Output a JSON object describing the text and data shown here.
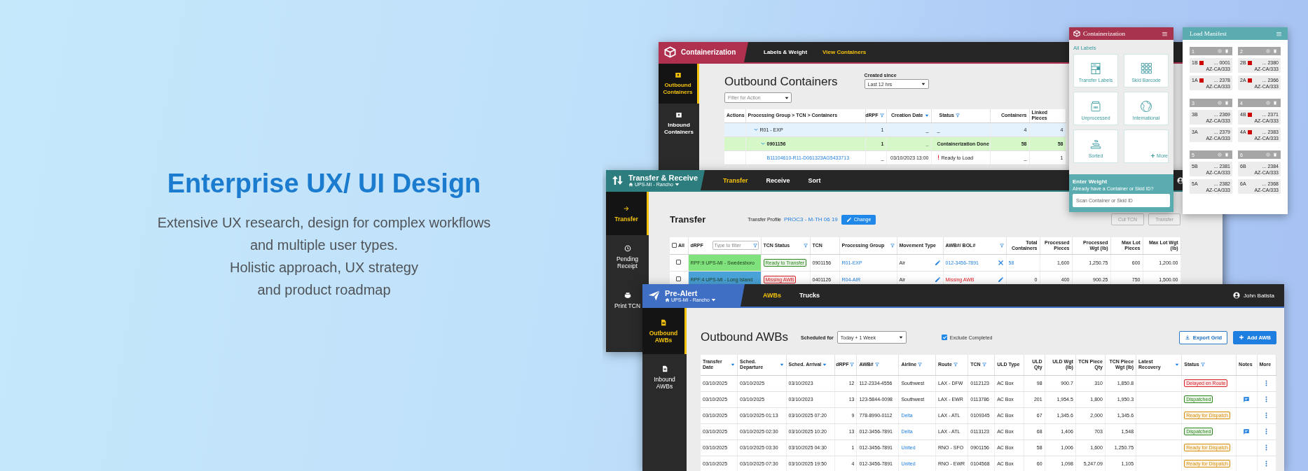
{
  "hero": {
    "title": "Enterprise UX/ UI Design",
    "lines": [
      "Extensive UX research, design for complex workflows",
      "and multiple user types.",
      "Holistic approach, UX strategy",
      "and product roadmap"
    ]
  },
  "containerization_window": {
    "app_title": "Containerization",
    "nav_tabs": [
      {
        "label": "Labels & Weight",
        "selected": false
      },
      {
        "label": "View Containers",
        "selected": true
      }
    ],
    "sidebar": [
      {
        "label": "Outbound Containers",
        "selected": true
      },
      {
        "label": "Inbound Containers",
        "selected": false
      }
    ],
    "page_title": "Outbound Containers",
    "created_since": {
      "label": "Created since",
      "value": "Last 12 hrs"
    },
    "action_filter": {
      "placeholder": "Filter for Action"
    },
    "table": {
      "columns": [
        {
          "label": "Actions"
        },
        {
          "label": "Processing Group > TCN > Containers"
        },
        {
          "label": "dRPF",
          "kind": "filter"
        },
        {
          "label": "Creation Date",
          "kind": "sort"
        },
        {
          "label": "Status",
          "kind": "filter"
        },
        {
          "label": "Containers"
        },
        {
          "label": "Linked Pieces"
        }
      ],
      "rows": [
        {
          "kind": "group",
          "expanded": true,
          "cells": [
            "",
            "R01 - EXP",
            "1",
            "_",
            "_",
            "4",
            "4"
          ]
        },
        {
          "kind": "tcn",
          "expanded": true,
          "cells": [
            "",
            "0901156",
            "1",
            "_",
            "Containerization Done",
            "58",
            "58"
          ]
        },
        {
          "kind": "container",
          "cells": [
            "",
            {
              "text": "B11104610-R11-D061323AG5433713",
              "kind": "link"
            },
            "_",
            "03/10/2023 13:00",
            {
              "text": "Ready to Load",
              "kind": "alert"
            },
            "_",
            "1"
          ]
        }
      ]
    }
  },
  "transfer_window": {
    "app_title": "Transfer & Receive",
    "location": "UPS-MI - Rancho",
    "nav_tabs": [
      {
        "label": "Transfer",
        "selected": true
      },
      {
        "label": "Receive",
        "selected": false
      },
      {
        "label": "Sort",
        "selected": false
      }
    ],
    "sidebar": [
      {
        "label": "Transfer",
        "selected": true
      },
      {
        "label": "Pending Receipt",
        "selected": false
      },
      {
        "label": "Print TCN",
        "selected": false
      }
    ],
    "page_title": "Transfer",
    "profile": {
      "label": "Transfer Profile",
      "value": "PROC3 - M-TH 06 19",
      "button": "Change"
    },
    "actions": [
      {
        "label": "Cut TCN",
        "disabled": true
      },
      {
        "label": "Transfer",
        "disabled": true
      }
    ],
    "table": {
      "columns": [
        {
          "label": "All",
          "kind": "select-all",
          "checked": false
        },
        {
          "label": "dRPF",
          "kind": "filter-field",
          "placeholder": "Type to filter"
        },
        {
          "label": "TCN Status",
          "kind": "filter"
        },
        {
          "label": "TCN"
        },
        {
          "label": "Processing Group",
          "kind": "filter"
        },
        {
          "label": "Movement Type"
        },
        {
          "label": "AWB#/ BOL#",
          "kind": "filter"
        },
        {
          "label": "Total Containers"
        },
        {
          "label": "Processed Pieces"
        },
        {
          "label": "Processed Wgt (lb)"
        },
        {
          "label": "Max Lot Pieces"
        },
        {
          "label": "Max Lot Wgt (lb)"
        }
      ],
      "rows": [
        {
          "cells": [
            {
              "kind": "checkbox",
              "checked": false
            },
            {
              "text": "RPF:9 UPS-MI - Swedesboro",
              "kind": "rpf",
              "color": "#7fe27c"
            },
            {
              "text": "Ready to Transfer",
              "kind": "badge",
              "color": "#2f8a1f"
            },
            "0901156",
            {
              "text": "R01-EXP",
              "kind": "link"
            },
            {
              "text": "Air",
              "kind": "editable"
            },
            {
              "text": "012-3456-7891",
              "kind": "clearable"
            },
            {
              "text": "58",
              "kind": "link"
            },
            "1,600",
            "1,250.75",
            "600",
            "1,200.00"
          ]
        },
        {
          "cells": [
            {
              "kind": "checkbox",
              "checked": false
            },
            {
              "text": "RPF:4 UPS-MI - Long Island",
              "kind": "rpf",
              "color": "#4aa3d8"
            },
            {
              "text": "Missing AWB",
              "kind": "badge",
              "color": "#d8232a"
            },
            "0401126",
            {
              "text": "R04-AIR",
              "kind": "link"
            },
            {
              "text": "Air",
              "kind": "editable"
            },
            {
              "text": "Missing AWB",
              "kind": "missing"
            },
            "0",
            "400",
            "900.25",
            "750",
            "1,500.00"
          ]
        }
      ]
    }
  },
  "prealert_window": {
    "app_title": "Pre-Alert",
    "location": "UPS-MI - Rancho",
    "nav_tabs": [
      {
        "label": "AWBs",
        "selected": true
      },
      {
        "label": "Trucks",
        "selected": false
      }
    ],
    "user": "John Batista",
    "sidebar": [
      {
        "label": "Outbound AWBs",
        "selected": true
      },
      {
        "label": "Inbound AWBs",
        "selected": false
      }
    ],
    "page_title": "Outbound AWBs",
    "schedule": {
      "label": "Scheduled for",
      "value": "Today + 1 Week"
    },
    "exclude_completed": {
      "label": "Exclude Completed",
      "checked": true
    },
    "buttons": [
      {
        "label": "Export Grid",
        "kind": "export"
      },
      {
        "label": "Add AWB",
        "kind": "add"
      }
    ],
    "table": {
      "columns": [
        {
          "label": "Transfer Date",
          "kind": "sort"
        },
        {
          "label": "Sched. Departure",
          "kind": "sort"
        },
        {
          "label": "Sched. Arrival",
          "kind": "sort"
        },
        {
          "label": "dRPF",
          "kind": "filter"
        },
        {
          "label": "AWB#",
          "kind": "filter"
        },
        {
          "label": "Airline",
          "kind": "filter"
        },
        {
          "label": "Route",
          "kind": "filter"
        },
        {
          "label": "TCN",
          "kind": "filter"
        },
        {
          "label": "ULD Type"
        },
        {
          "label": "ULD Qty"
        },
        {
          "label": "ULD Wgt (lb)"
        },
        {
          "label": "TCN Piece Qty"
        },
        {
          "label": "TCN Piece Wgt (lb)"
        },
        {
          "label": "Latest Recovery",
          "kind": "sort"
        },
        {
          "label": "Status",
          "kind": "filter"
        },
        {
          "label": "Notes"
        },
        {
          "label": "More"
        }
      ],
      "rows": [
        {
          "has_note": false,
          "cells": [
            "03/10/2025",
            "03/10/2025",
            "03/10/2023",
            "12",
            "112-2334-4556",
            "Southwest",
            "LAX - DFW",
            "0112123",
            "AC Box",
            "98",
            "900.7",
            "310",
            "1,850.8",
            null,
            {
              "text": "Delayed en Route",
              "kind": "badge",
              "color": "#d8232a"
            }
          ]
        },
        {
          "has_note": true,
          "cells": [
            "03/10/2025",
            "03/10/2025",
            "03/10/2023",
            "13",
            "123-5844-0098",
            "Southwest",
            "LAX - EWR",
            "0113786",
            "AC Box",
            "201",
            "1,954.5",
            "1,800",
            "1,950.3",
            null,
            {
              "text": "Dispatched",
              "kind": "badge",
              "color": "#2f8a1f"
            }
          ]
        },
        {
          "has_note": false,
          "cells": [
            "03/10/2025",
            "03/10/2025 01:13",
            "03/10/2025 07:20",
            "9",
            "778-8990-0112",
            {
              "text": "Delta",
              "kind": "link"
            },
            "LAX - ATL",
            "0109345",
            "AC Box",
            "67",
            "1,345.6",
            "2,000",
            "1,345.6",
            null,
            {
              "text": "Ready for Dispatch",
              "kind": "badge",
              "color": "#d8900c"
            }
          ]
        },
        {
          "has_note": true,
          "cells": [
            "03/10/2025",
            "03/10/2025 02:30",
            "03/10/2025 10:20",
            "13",
            "012-3456-7891",
            {
              "text": "Delta",
              "kind": "link"
            },
            "LAX - ATL",
            "0113123",
            "AC Box",
            "68",
            "1,406",
            "703",
            "1,548",
            null,
            {
              "text": "Dispatched",
              "kind": "badge",
              "color": "#2f8a1f"
            }
          ]
        },
        {
          "has_note": false,
          "cells": [
            "03/10/2025",
            "03/10/2025 03:30",
            "03/10/2025 04:30",
            "1",
            "012-3456-7891",
            {
              "text": "United",
              "kind": "link"
            },
            "RNO - SFO",
            "0901156",
            "AC Box",
            "58",
            "1,006",
            "1,600",
            "1,250.75",
            null,
            {
              "text": "Ready for Dispatch",
              "kind": "badge",
              "color": "#d8900c"
            }
          ]
        },
        {
          "has_note": false,
          "cells": [
            "03/10/2025",
            "03/10/2025 07:30",
            "03/10/2025 19:50",
            "4",
            "012-3456-7891",
            {
              "text": "United",
              "kind": "link"
            },
            "RNO - EWR",
            "0104568",
            "AC Box",
            "60",
            "1,098",
            "5,247.09",
            "1,105",
            null,
            {
              "text": "Ready for Dispatch",
              "kind": "badge",
              "color": "#d8900c"
            }
          ]
        }
      ]
    }
  },
  "labels_panel": {
    "title": "Containerization",
    "section": "All Labels",
    "tiles": [
      {
        "label": "Transfer Labels",
        "kind": "tile"
      },
      {
        "label": "Skid Barcode",
        "kind": "tile"
      },
      {
        "label": "Unprocessed",
        "kind": "tile"
      },
      {
        "label": "International",
        "kind": "tile"
      },
      {
        "label": "Sorted",
        "kind": "tile"
      },
      {
        "label": "More",
        "kind": "more"
      }
    ],
    "weight": {
      "title": "Enter Weight",
      "prompt": "Already have a Container or Skid ID?",
      "placeholder": "Scan Container or Skid ID"
    }
  },
  "load_manifest": {
    "title": "Load Manifest",
    "groups": [
      {
        "number": "1",
        "items": [
          {
            "slot": "1B",
            "flagged": true,
            "id": "... 0001",
            "route": "AZ-CA/333"
          },
          {
            "slot": "1A",
            "flagged": true,
            "id": "... 2378",
            "route": "AZ-CA/333"
          }
        ]
      },
      {
        "number": "2",
        "items": [
          {
            "slot": "2B",
            "flagged": true,
            "id": "... 2380",
            "route": "AZ-CA/333"
          },
          {
            "slot": "2A",
            "flagged": true,
            "id": "... 2366",
            "route": "AZ-CA/333"
          }
        ]
      },
      {
        "number": "3",
        "items": [
          {
            "slot": "3B",
            "flagged": false,
            "id": "... 2369",
            "route": "AZ-CA/333"
          },
          {
            "slot": "3A",
            "flagged": false,
            "id": "... 2379",
            "route": "AZ-CA/333"
          }
        ]
      },
      {
        "number": "4",
        "items": [
          {
            "slot": "4B",
            "flagged": true,
            "id": "... 2371",
            "route": "AZ-CA/333"
          },
          {
            "slot": "4A",
            "flagged": true,
            "id": "... 2383",
            "route": "AZ-CA/333"
          }
        ]
      },
      {
        "number": "5",
        "items": [
          {
            "slot": "5B",
            "flagged": false,
            "id": "... 2381",
            "route": "AZ-CA/333"
          },
          {
            "slot": "5A",
            "flagged": false,
            "id": "... 2382",
            "route": "AZ-CA/333"
          }
        ]
      },
      {
        "number": "6",
        "items": [
          {
            "slot": "6B",
            "flagged": false,
            "id": "... 2384",
            "route": "AZ-CA/333"
          },
          {
            "slot": "6A",
            "flagged": false,
            "id": "... 2368",
            "route": "AZ-CA/333"
          }
        ]
      }
    ]
  }
}
